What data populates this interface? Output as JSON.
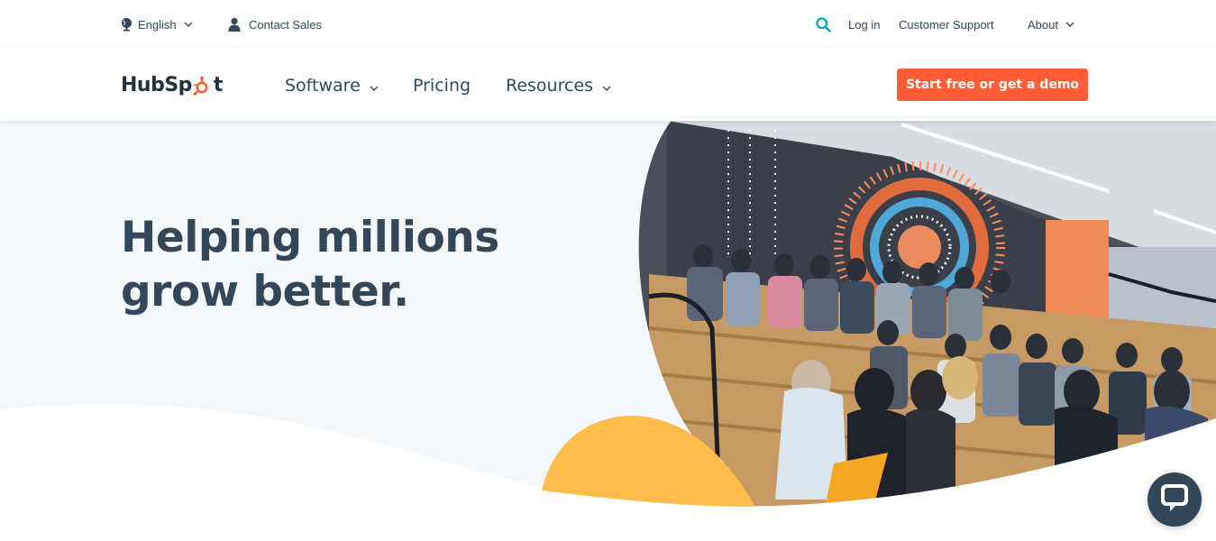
{
  "utility": {
    "language_label": "English",
    "contact_sales_label": "Contact Sales",
    "login_label": "Log in",
    "support_label": "Customer Support",
    "about_label": "About"
  },
  "nav": {
    "brand_left": "HubSp",
    "brand_right": "t",
    "software_label": "Software",
    "pricing_label": "Pricing",
    "resources_label": "Resources",
    "cta_label": "Start free or get a demo"
  },
  "hero": {
    "headline_line1": "Helping millions",
    "headline_line2": "grow better."
  },
  "colors": {
    "brand_orange": "#ff5c35",
    "text_dark": "#33475b",
    "hero_bg": "#f5f8fa",
    "accent_yellow": "#ffbc4b",
    "search_teal": "#00a4bd"
  },
  "icons": {
    "globe": "globe-icon",
    "person": "person-icon",
    "search": "search-icon",
    "chevron": "chevron-down-icon",
    "chat": "chat-icon"
  }
}
